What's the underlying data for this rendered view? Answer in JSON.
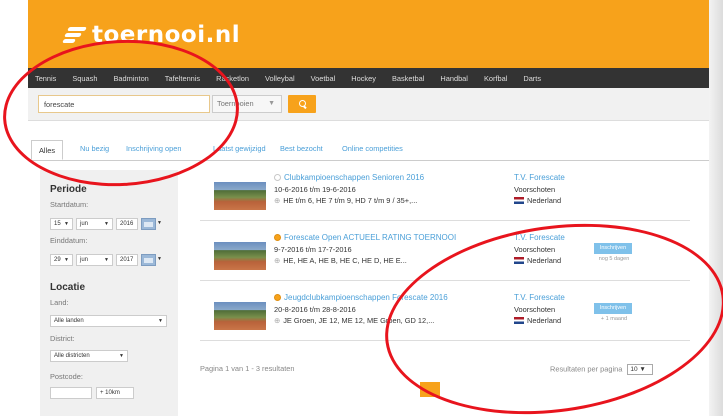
{
  "brand": {
    "logo_text": "toernooi.nl"
  },
  "nav": {
    "items": [
      "Tennis",
      "Squash",
      "Badminton",
      "Tafeltennis",
      "Racketlon",
      "Volleybal",
      "Voetbal",
      "Hockey",
      "Basketbal",
      "Handbal",
      "Korfbal",
      "Darts"
    ]
  },
  "search": {
    "value": "forescate",
    "category": "Toernooien",
    "icons": {
      "button": "search-icon",
      "dropdown": "chevron-down-icon"
    }
  },
  "tabs": [
    "Alles",
    "Nu bezig",
    "Inschrijving open",
    "Laatst gewijzigd",
    "Best bezocht",
    "Online competities"
  ],
  "sidebar": {
    "periode_title": "Periode",
    "start_label": "Startdatum:",
    "start": {
      "day": "15",
      "month": "jun",
      "year": "2016"
    },
    "end_label": "Einddatum:",
    "end": {
      "day": "29",
      "month": "jun",
      "year": "2017"
    },
    "locatie_title": "Locatie",
    "land_label": "Land:",
    "land_value": "Alle landen",
    "district_label": "District:",
    "district_value": "Alle districten",
    "postcode_label": "Postcode:",
    "postcode_value": "",
    "radius_value": "+ 10km"
  },
  "results": [
    {
      "title": "Clubkampioenschappen Senioren 2016",
      "dates": "10-6-2016 t/m 19-6-2016",
      "events": "HE t/m 6, HE 7 t/m 9, HD 7 t/m 9 / 35+,...",
      "club": "T.V. Forescate",
      "city": "Voorschoten",
      "country": "Nederland",
      "status_icon": "inactive",
      "badge": "",
      "badge_sub": ""
    },
    {
      "title": "Forescate Open ACTUEEL RATING TOERNOOI",
      "dates": "9-7-2016 t/m 17-7-2016",
      "events": "HE, HE A, HE B, HE C, HE D, HE E...",
      "club": "T.V. Forescate",
      "city": "Voorschoten",
      "country": "Nederland",
      "status_icon": "active",
      "badge": "Inschrijven",
      "badge_sub": "nog 5 dagen"
    },
    {
      "title": "Jeugdclubkampioenschappen Forescate 2016",
      "dates": "20-8-2016 t/m 28-8-2016",
      "events": "JE Groen, JE 12, ME 12, ME Groen, GD 12,...",
      "club": "T.V. Forescate",
      "city": "Voorschoten",
      "country": "Nederland",
      "status_icon": "active",
      "badge": "Inschrijven",
      "badge_sub": "+ 1 maand"
    }
  ],
  "pagination": {
    "summary": "Pagina 1 van 1 - 3 resultaten",
    "per_page_label": "Resultaten per pagina",
    "per_page_value": "10"
  },
  "annotations": {
    "color": "#e8141d"
  },
  "colors": {
    "brand_orange": "#f7a21b",
    "nav_bg": "#333333",
    "link": "#4a9fd8"
  }
}
